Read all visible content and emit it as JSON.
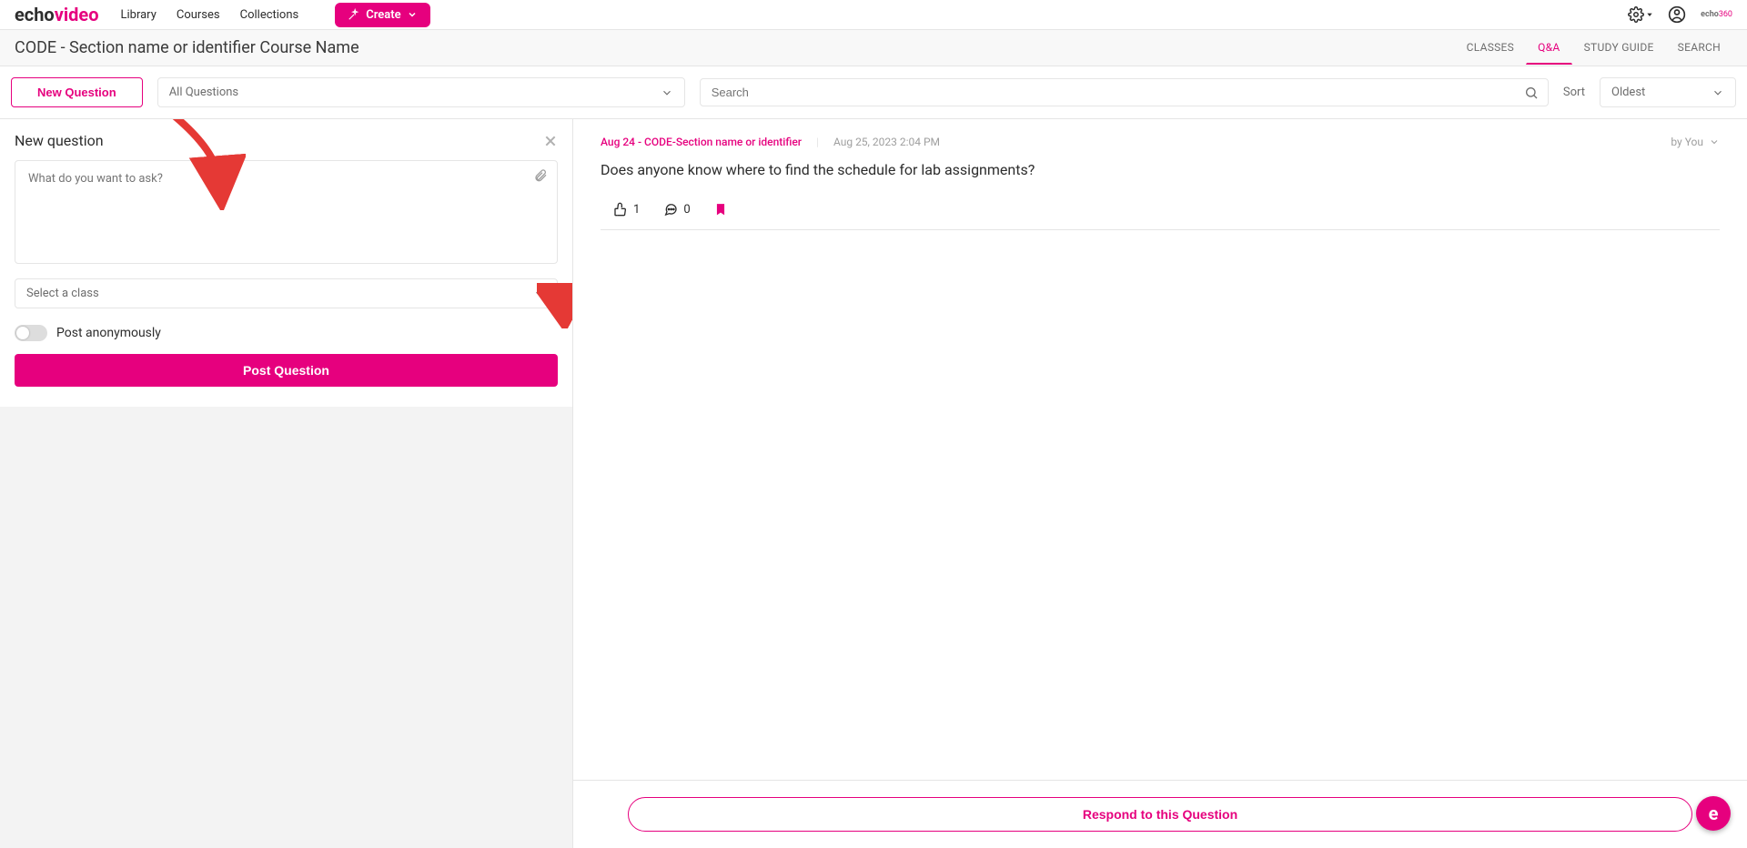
{
  "nav": {
    "logo_left": "echo",
    "logo_right": "video",
    "links": [
      "Library",
      "Courses",
      "Collections"
    ],
    "create_label": "Create",
    "small_logo_left": "echo",
    "small_logo_right": "360"
  },
  "course": {
    "title": "CODE - Section name or identifier Course Name",
    "tabs": [
      "CLASSES",
      "Q&A",
      "STUDY GUIDE",
      "SEARCH"
    ],
    "active_tab": "Q&A"
  },
  "filter": {
    "new_question_btn": "New Question",
    "questions_filter": "All Questions",
    "search_placeholder": "Search",
    "sort_label": "Sort",
    "sort_value": "Oldest"
  },
  "form": {
    "title": "New question",
    "textarea_placeholder": "What do you want to ask?",
    "class_select_placeholder": "Select a class",
    "anonymous_label": "Post anonymously",
    "post_btn": "Post Question"
  },
  "question": {
    "class_label": "Aug 24 - CODE-Section name or identifier",
    "posted_at": "Aug 25, 2023 2:04 PM",
    "author": "by You",
    "text": "Does anyone know where to find the schedule for lab assignments?",
    "like_count": "1",
    "reply_count": "0",
    "respond_btn": "Respond to this Question"
  },
  "help_bubble": "e"
}
